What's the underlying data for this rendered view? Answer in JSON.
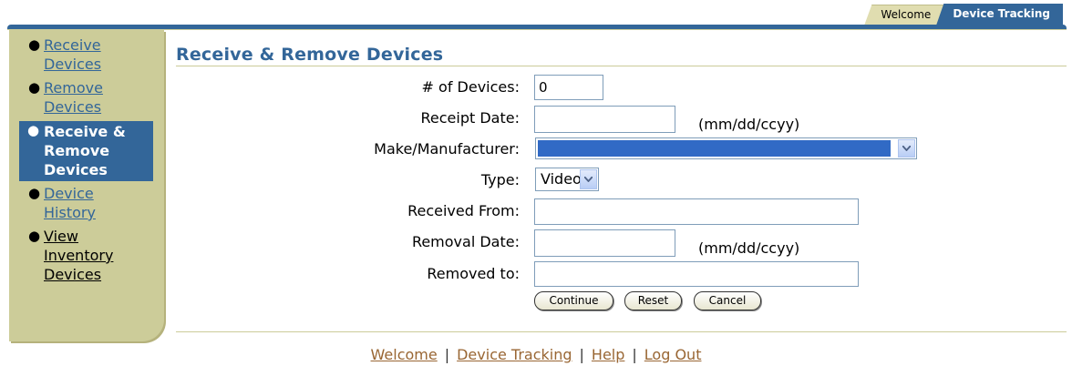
{
  "tabs": [
    {
      "label": "Welcome",
      "active": false
    },
    {
      "label": "Device Tracking",
      "active": true
    }
  ],
  "sidebar": {
    "items": [
      {
        "label": "Receive Devices",
        "active": false
      },
      {
        "label": "Remove Devices",
        "active": false
      },
      {
        "label": "Receive & Remove Devices",
        "active": true
      },
      {
        "label": "Device History",
        "active": false
      },
      {
        "label": "View Inventory Devices",
        "active": false
      }
    ]
  },
  "page": {
    "title": "Receive & Remove Devices"
  },
  "form": {
    "num_devices": {
      "label": "# of Devices:",
      "value": "0"
    },
    "receipt_date": {
      "label": "Receipt Date:",
      "value": "",
      "hint": "(mm/dd/ccyy)"
    },
    "make": {
      "label": "Make/Manufacturer:",
      "value": ""
    },
    "type": {
      "label": "Type:",
      "value": "Video"
    },
    "received_from": {
      "label": "Received From:",
      "value": ""
    },
    "removal_date": {
      "label": "Removal Date:",
      "value": "",
      "hint": "(mm/dd/ccyy)"
    },
    "removed_to": {
      "label": "Removed to:",
      "value": ""
    }
  },
  "buttons": {
    "continue": "Continue",
    "reset": "Reset",
    "cancel": "Cancel"
  },
  "footer": {
    "links": [
      "Welcome",
      "Device Tracking",
      "Help",
      "Log Out"
    ],
    "separator": "|"
  },
  "colors": {
    "accent": "#336699",
    "sidebar": "#cccc99",
    "footer_link": "#996633",
    "selected": "#316ac5"
  }
}
